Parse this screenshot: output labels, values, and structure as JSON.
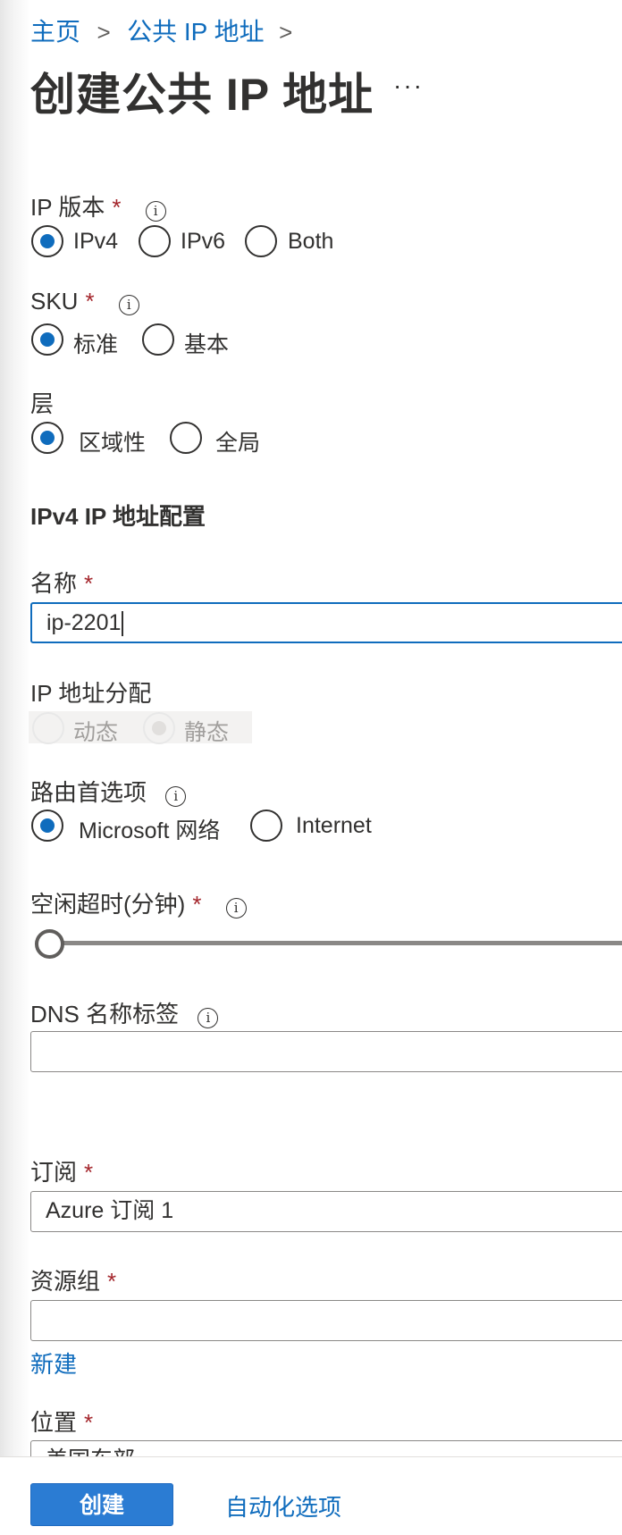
{
  "breadcrumb": {
    "items": [
      "主页",
      "公共 IP 地址"
    ],
    "separator": ">"
  },
  "page": {
    "title": "创建公共 IP 地址",
    "more": "···"
  },
  "required_mark": "*",
  "info_glyph": "i",
  "ip_version": {
    "label": "IP 版本",
    "options": [
      "IPv4",
      "IPv6",
      "Both"
    ],
    "selected": "IPv4"
  },
  "sku": {
    "label": "SKU",
    "options": [
      "标准",
      "基本"
    ],
    "selected": "标准"
  },
  "tier": {
    "label": "层",
    "options": [
      "区域性",
      "全局"
    ],
    "selected": "区域性"
  },
  "config_section": {
    "title": "IPv4 IP 地址配置"
  },
  "name": {
    "label": "名称",
    "value": "ip-2201"
  },
  "assignment": {
    "label": "IP 地址分配",
    "options": [
      "动态",
      "静态"
    ],
    "selected": "静态",
    "disabled": true
  },
  "routing": {
    "label": "路由首选项",
    "options": [
      "Microsoft 网络",
      "Internet"
    ],
    "selected": "Microsoft 网络"
  },
  "idle_timeout": {
    "label": "空闲超时(分钟)",
    "value_fraction": 0
  },
  "dns": {
    "label": "DNS 名称标签",
    "value": ""
  },
  "subscription": {
    "label": "订阅",
    "value": "Azure 订阅 1"
  },
  "resource_group": {
    "label": "资源组",
    "value": "",
    "create_new": "新建"
  },
  "location": {
    "label": "位置",
    "value": "美国东部"
  },
  "footer": {
    "create": "创建",
    "automation": "自动化选项"
  },
  "colors": {
    "accent": "#0f6cbd",
    "primary_button": "#2b7cd3",
    "required": "#a4262c"
  }
}
